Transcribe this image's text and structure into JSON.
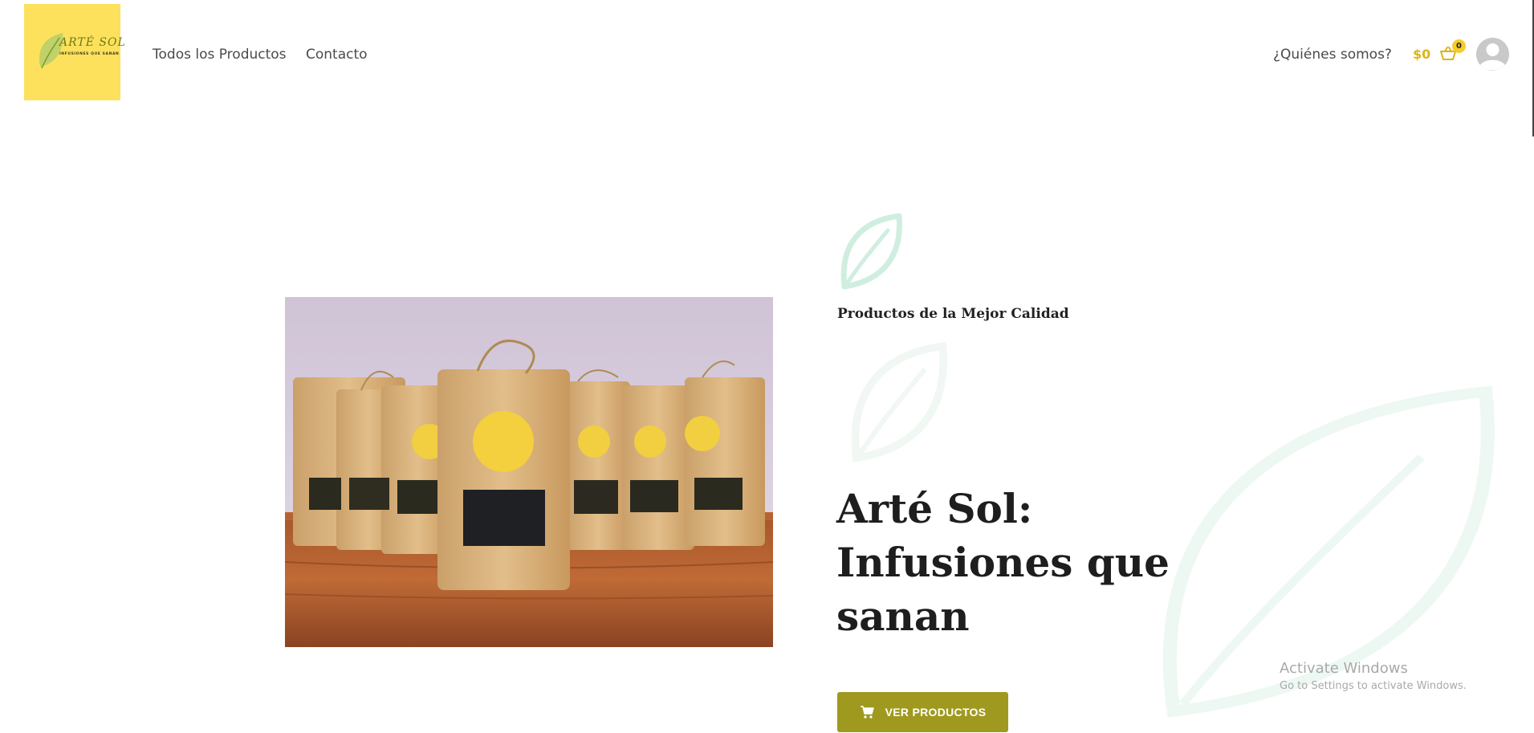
{
  "logo": {
    "title": "ARTÉ SOL",
    "tagline": "INFUSIONES QUE SANAN",
    "background": "#fde15c"
  },
  "nav": {
    "items": [
      "Todos los Productos",
      "Contacto"
    ],
    "about": "¿Quiénes somos?"
  },
  "cart": {
    "amount": "$0",
    "count": "0",
    "icon": "shopping-basket-icon",
    "accent": "#e0b316"
  },
  "user": {
    "icon": "user-avatar-icon"
  },
  "hero": {
    "subtitle": "Productos de la Mejor Calidad",
    "title": "Arté Sol: Infusiones que sanan",
    "button_label": "VER PRODUCTOS",
    "button_icon": "shopping-cart-icon",
    "button_color": "#9f9a1f",
    "leaf_icon": "leaf-icon",
    "photo_alt": "Bolsas kraft de infusiones Arté Sol sobre una mesa de madera"
  },
  "watermark": {
    "line1": "Activate Windows",
    "line2": "Go to Settings to activate Windows."
  }
}
